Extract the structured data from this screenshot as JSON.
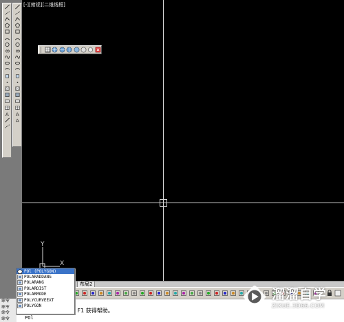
{
  "viewport": {
    "label": "[-][俯视][二维线框]"
  },
  "tabs": {
    "layout2": "布局2"
  },
  "command": {
    "prompts": [
      "命令",
      "命令",
      "命令",
      "命令"
    ],
    "help_text": "按 F1 获得帮助。",
    "input_value": "POl"
  },
  "autocomplete": {
    "items": [
      {
        "label": "POl (POLYGON)",
        "selected": true
      },
      {
        "label": "POLARADDANG",
        "selected": false
      },
      {
        "label": "POLARANG",
        "selected": false
      },
      {
        "label": "POLARDIST",
        "selected": false
      },
      {
        "label": "POLARMODE",
        "selected": false
      },
      {
        "label": "POLYCURVEEXT",
        "selected": false
      },
      {
        "label": "POLYGON",
        "selected": false
      }
    ]
  },
  "ucs": {
    "x_label": "X",
    "y_label": "Y"
  },
  "watermark": {
    "title": "溜溜自学",
    "url": "ZIXUE.3D66.COM"
  },
  "colors": {
    "canvas": "#000000",
    "crosshair": "#d8d8d8",
    "selected": "#3a73c8",
    "toolbar": "#d4d0c8"
  },
  "icons": {
    "left_toolbar_1": [
      "line-icon",
      "construction-line-icon",
      "polyline-icon",
      "polygon-icon",
      "rectangle-icon",
      "arc-icon",
      "circle-icon",
      "revision-cloud-icon",
      "spline-icon",
      "ellipse-icon",
      "ellipse-arc-icon",
      "insert-block-icon",
      "make-block-icon",
      "point-icon",
      "hatch-icon",
      "gradient-icon",
      "region-icon",
      "table-icon",
      "multiline-text-icon",
      "add-selected-icon"
    ],
    "left_toolbar_2": [
      "line-icon",
      "ray-icon",
      "polyline-icon",
      "polygon-icon",
      "rectangle-icon",
      "arc-icon",
      "circle-icon",
      "donut-icon",
      "spline-icon",
      "ellipse-icon",
      "ellipse-arc-icon",
      "block-icon",
      "point-icon",
      "hatch-icon",
      "gradient-icon",
      "boundary-icon",
      "region-icon",
      "wipeout-icon",
      "text-icon"
    ]
  }
}
